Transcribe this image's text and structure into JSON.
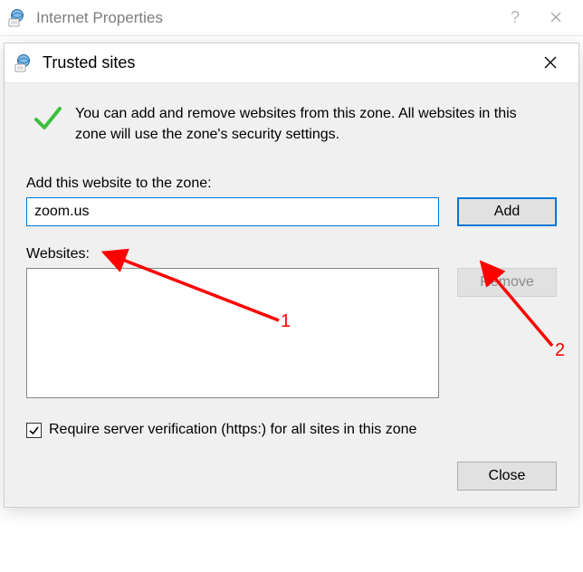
{
  "parentWindow": {
    "title": "Internet Properties"
  },
  "dialog": {
    "title": "Trusted sites",
    "introText": "You can add and remove websites from this zone. All websites in this zone will use the zone's security settings.",
    "addLabel": "Add this website to the zone:",
    "inputValue": "zoom.us",
    "addButton": "Add",
    "websitesLabel": "Websites:",
    "removeButton": "Remove",
    "checkboxLabel": "Require server verification (https:) for all sites in this zone",
    "checkboxChecked": true,
    "closeButton": "Close"
  },
  "annotations": {
    "mark1": "1",
    "mark2": "2"
  }
}
